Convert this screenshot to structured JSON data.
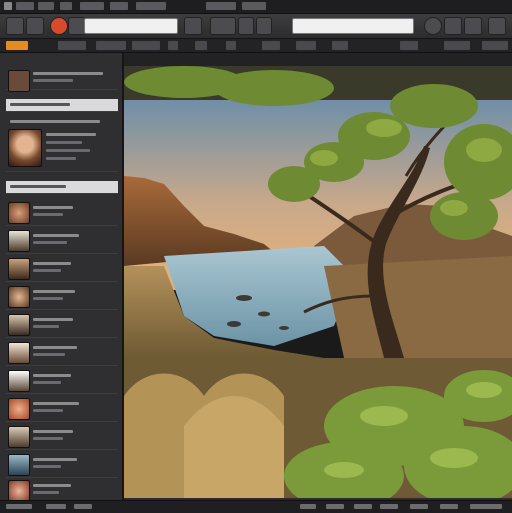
{
  "menubar": {
    "items_count": 8
  },
  "toolbar": {
    "accent": "#e98a1d"
  },
  "viewer": {
    "content": "landscape-photo"
  },
  "colors": {
    "sky_top": "#6f8fa8",
    "sky_bottom": "#e8b27a",
    "water": "#8fb7c8",
    "foliage": "#7b9a3a",
    "grass": "#b4915a"
  }
}
